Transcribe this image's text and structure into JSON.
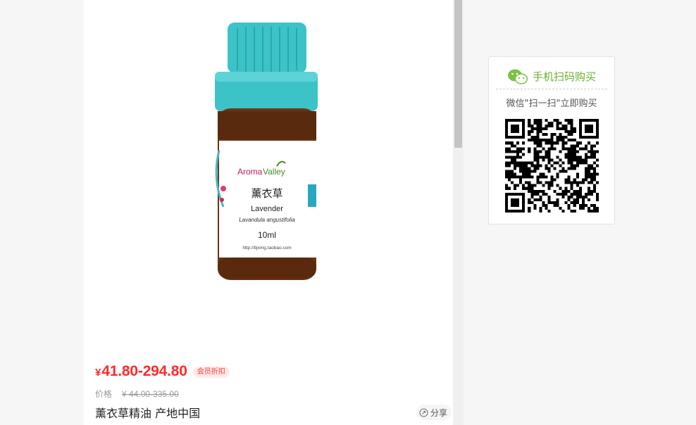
{
  "product": {
    "image_alt": "Lavender essential oil bottle",
    "bottle_label": {
      "brand": "AromaValley",
      "name_cn": "薰衣草",
      "name_en": "Lavender",
      "latin": "Lavandula angustifolia",
      "volume": "10ml",
      "url": "http://bjxmg.taobao.com"
    },
    "price_symbol": "¥",
    "price": "41.80-294.80",
    "member_badge": "会员折扣",
    "old_price_label": "价格",
    "old_price": "¥ 44.00-335.00",
    "title": "薰衣草精油 产地中国",
    "share_label": "分享"
  },
  "qr": {
    "header": "手机扫码购买",
    "subtitle": "微信\"扫一扫\"立即购买"
  },
  "colors": {
    "price": "#ff2a2a",
    "wechat_green": "#6bb02e",
    "cap": "#3cc3c8"
  }
}
